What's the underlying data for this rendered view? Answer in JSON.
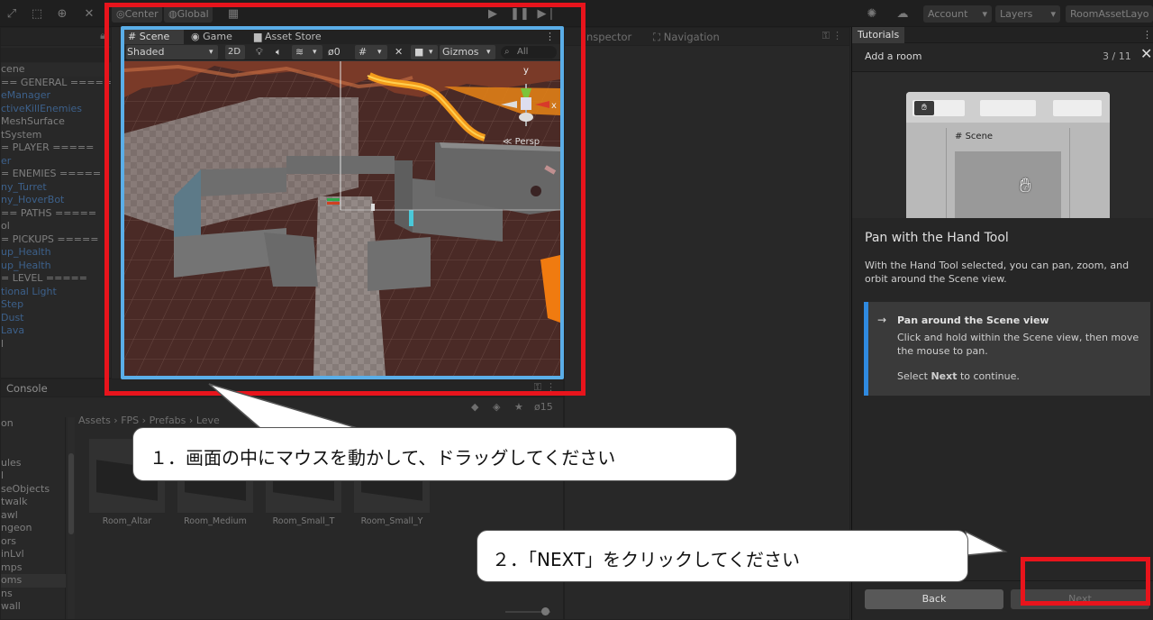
{
  "toolbar": {
    "center_label": "Center",
    "global_label": "Global",
    "account_label": "Account",
    "layers_label": "Layers",
    "layout_label": "RoomAssetLayo"
  },
  "hierarchy": {
    "items": [
      {
        "label": "cene",
        "color": "white",
        "arrow": false
      },
      {
        "label": "== GENERAL =====",
        "color": "white",
        "arrow": false
      },
      {
        "label": "eManager",
        "color": "blue",
        "arrow": true
      },
      {
        "label": "ctiveKillEnemies",
        "color": "blue",
        "arrow": true
      },
      {
        "label": "MeshSurface",
        "color": "white",
        "arrow": false
      },
      {
        "label": "tSystem",
        "color": "white",
        "arrow": false
      },
      {
        "label": "= PLAYER =====",
        "color": "white",
        "arrow": false
      },
      {
        "label": "er",
        "color": "blue",
        "arrow": true
      },
      {
        "label": "= ENEMIES =====",
        "color": "white",
        "arrow": false
      },
      {
        "label": "ny_Turret",
        "color": "blue",
        "arrow": true
      },
      {
        "label": "ny_HoverBot",
        "color": "blue",
        "arrow": true
      },
      {
        "label": "== PATHS =====",
        "color": "white",
        "arrow": false
      },
      {
        "label": "ol",
        "color": "white",
        "arrow": false
      },
      {
        "label": "= PICKUPS =====",
        "color": "white",
        "arrow": false
      },
      {
        "label": "up_Health",
        "color": "blue",
        "arrow": true
      },
      {
        "label": "up_Health",
        "color": "blue",
        "arrow": true
      },
      {
        "label": "= LEVEL =====",
        "color": "white",
        "arrow": false
      },
      {
        "label": "tional Light",
        "color": "blue",
        "arrow": true
      },
      {
        "label": "Step",
        "color": "blue",
        "arrow": true
      },
      {
        "label": "Dust",
        "color": "blue",
        "arrow": true
      },
      {
        "label": "Lava",
        "color": "blue",
        "arrow": true
      },
      {
        "label": "l",
        "color": "white",
        "arrow": false
      }
    ]
  },
  "console": {
    "tab_label": "Console",
    "hidden_count": "15",
    "breadcrumb": [
      "Assets",
      "FPS",
      "Prefabs",
      "Leve"
    ],
    "folders": [
      "on",
      "",
      "",
      "ules",
      "l",
      "seObjects",
      "twalk",
      "awl",
      "ngeon",
      "ors",
      "inLvl",
      "mps",
      "oms",
      "ns",
      "wall"
    ],
    "assets": [
      "Room_Altar",
      "Room_Medium",
      "Room_Small_T",
      "Room_Small_Y"
    ]
  },
  "scene": {
    "tabs": {
      "scene": "Scene",
      "game": "Game",
      "asset_store": "Asset Store"
    },
    "shading_mode": "Shaded",
    "mode_2d": "2D",
    "hidden_count": "0",
    "gizmos_label": "Gizmos",
    "search_placeholder": "All",
    "gizmo_y": "y",
    "gizmo_x": "x",
    "persp_label": "Persp"
  },
  "inspector": {
    "tabs": {
      "inspector": "nspector",
      "navigation": "Navigation"
    }
  },
  "tutorial": {
    "tab_label": "Tutorials",
    "header_title": "Add a room",
    "progress": "3 / 11",
    "illustration_label": "Scene",
    "heading": "Pan with the Hand Tool",
    "description": "With the Hand Tool selected, you can pan, zoom, and orbit around the Scene view.",
    "task_title": "Pan around the Scene view",
    "task_body": "Click and hold within the Scene view, then move the mouse to pan.",
    "task_footer_prefix": "Select ",
    "task_footer_bold": "Next",
    "task_footer_suffix": " to continue.",
    "back_label": "Back",
    "next_label": "Next"
  },
  "annotations": {
    "callout_1": "１．画面の中にマウスを動かして、ドラッグしてください",
    "callout_2": "２．「NEXT」をクリックしてください"
  },
  "colors": {
    "highlight_red": "#e8141c",
    "scene_frame_blue": "#5aaee8",
    "hierarchy_blue": "#4d8edb",
    "lava_orange": "#f07b10"
  }
}
